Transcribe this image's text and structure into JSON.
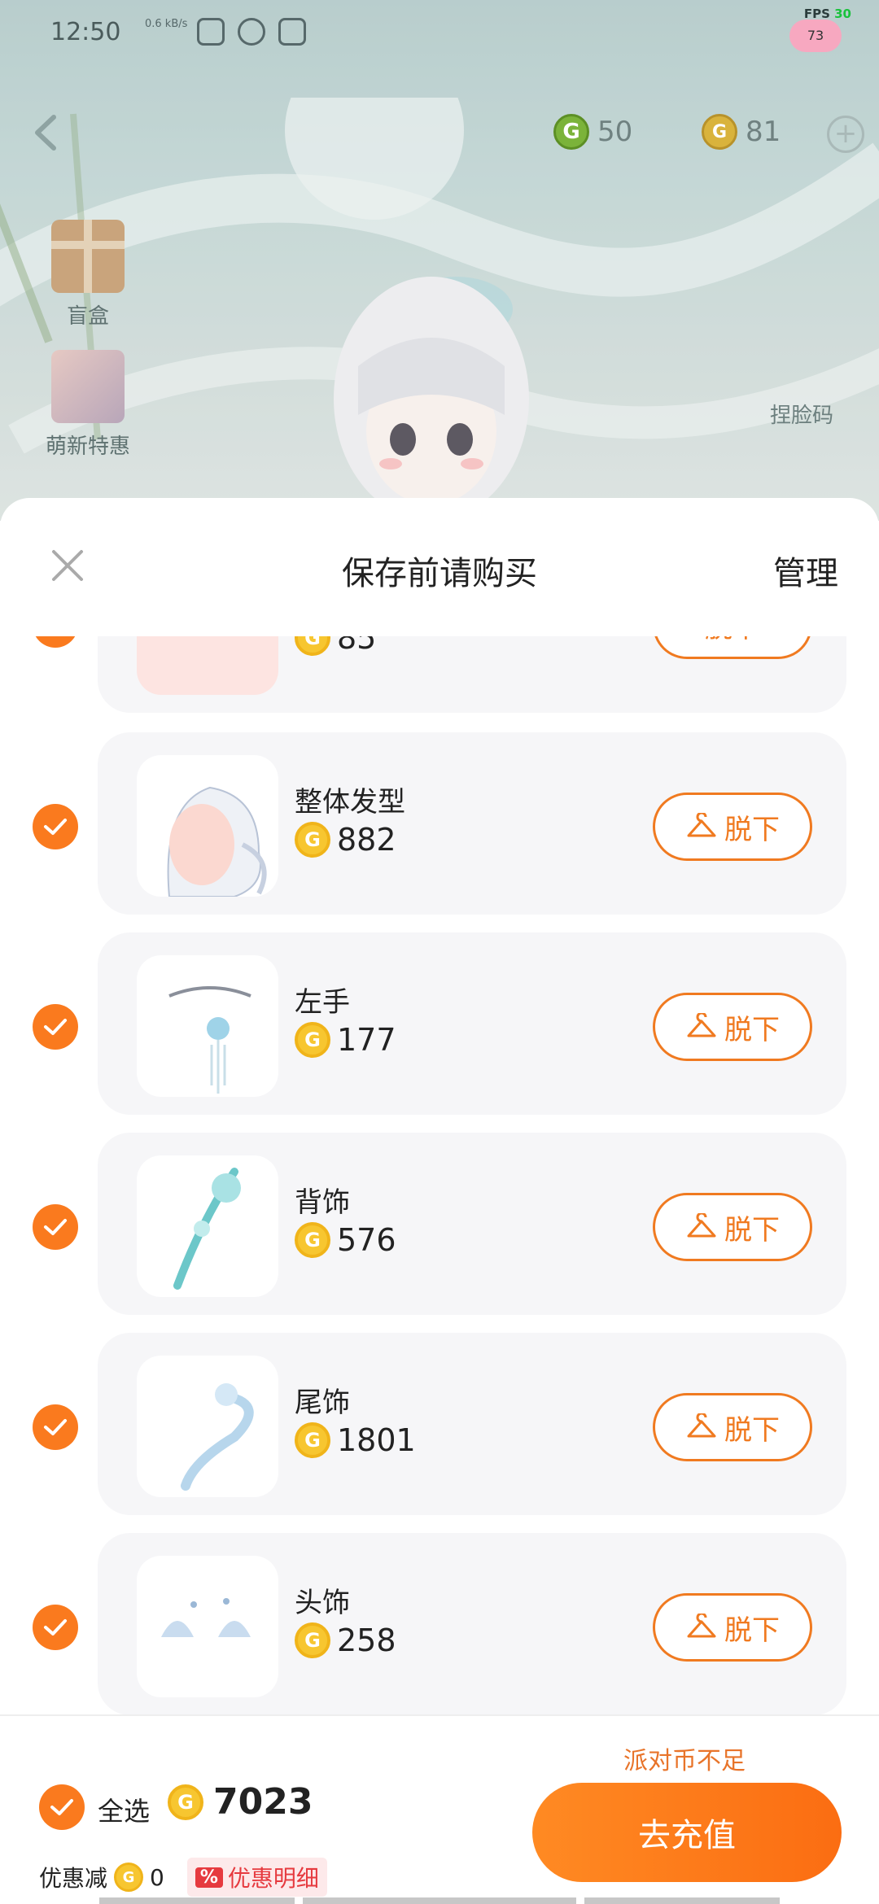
{
  "status_bar": {
    "time": "12:50",
    "net_speed": "0.6 kB/s",
    "fps_label": "FPS",
    "fps_value": "30",
    "pet_value": "73"
  },
  "top_bar": {
    "green_currency": "50",
    "gold_currency": "81",
    "side_items": [
      "盲盒",
      "萌新特惠"
    ],
    "face_label": "捏脸码"
  },
  "sheet": {
    "title": "保存前请购买",
    "manage_label": "管理",
    "coin_symbol": "G",
    "take_off_label": "脱下",
    "items": [
      {
        "name": "",
        "price": "85"
      },
      {
        "name": "整体发型",
        "price": "882"
      },
      {
        "name": "左手",
        "price": "177"
      },
      {
        "name": "背饰",
        "price": "576"
      },
      {
        "name": "尾饰",
        "price": "1801"
      },
      {
        "name": "头饰",
        "price": "258"
      }
    ]
  },
  "footer": {
    "select_all_label": "全选",
    "total": "7023",
    "discount_label": "优惠减",
    "discount_value": "0",
    "discount_detail_label": "优惠明细",
    "percent_symbol": "%",
    "warning": "派对币不足",
    "recharge_label": "去充值"
  },
  "colors": {
    "accent": "#fa7a1e",
    "gold": "#f7c630",
    "card_bg": "#f6f6f8",
    "discount_red": "#e63a3f"
  }
}
